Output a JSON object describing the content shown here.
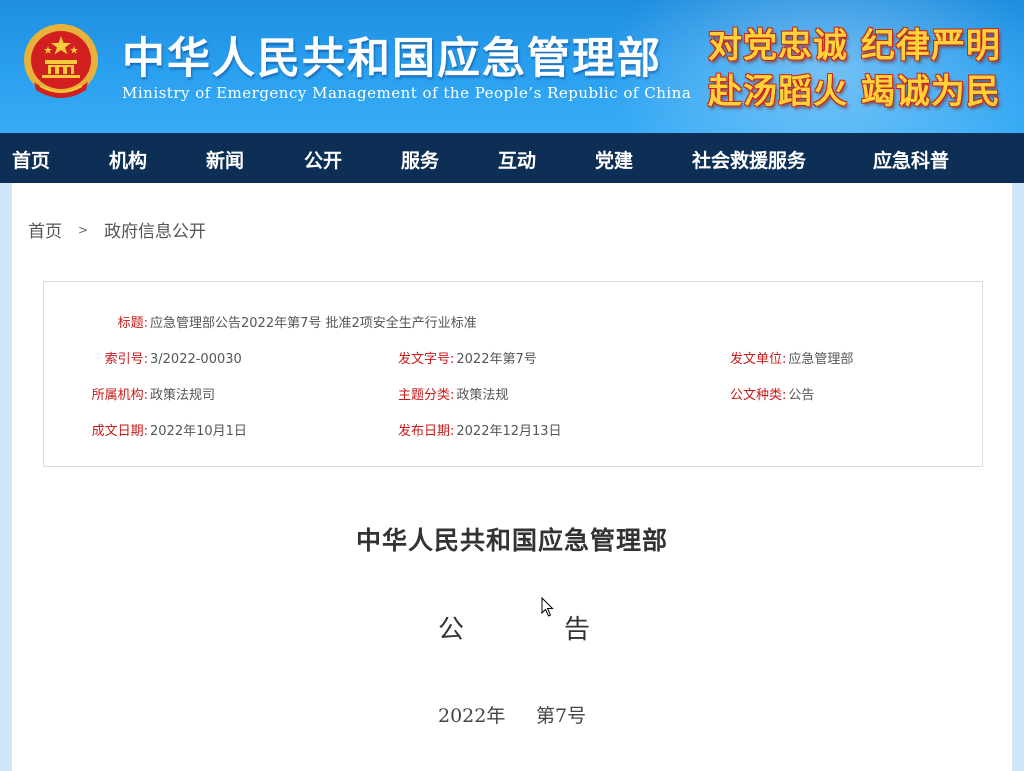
{
  "header": {
    "title": "中华人民共和国应急管理部",
    "subtitle": "Ministry of Emergency Management of the People’s Republic of China",
    "slogan_line1": "对党忠诚 纪律严明",
    "slogan_line2": "赴汤蹈火 竭诚为民",
    "emblem_icon": "national-emblem-icon"
  },
  "nav": {
    "items": [
      "首页",
      "机构",
      "新闻",
      "公开",
      "服务",
      "互动",
      "党建",
      "社会救援服务",
      "应急科普"
    ]
  },
  "breadcrumb": {
    "home": "首页",
    "separator": ">",
    "current": "政府信息公开"
  },
  "meta": {
    "title_label": "标题:",
    "title_value": "应急管理部公告2022年第7号 批准2项安全生产行业标准",
    "index_label": "索引号:",
    "index_value": "3/2022-00030",
    "doc_no_label": "发文字号:",
    "doc_no_value": "2022年第7号",
    "issuer_label": "发文单位:",
    "issuer_value": "应急管理部",
    "org_label": "所属机构:",
    "org_value": "政策法规司",
    "topic_label": "主题分类:",
    "topic_value": "政策法规",
    "doc_kind_label": "公文种类:",
    "doc_kind_value": "公告",
    "written_label": "成文日期:",
    "written_value": "2022年10月1日",
    "published_label": "发布日期:",
    "published_value": "2022年12月13日"
  },
  "document": {
    "org_name": "中华人民共和国应急管理部",
    "type_char1": "公",
    "type_char2": "告",
    "year": "2022年",
    "number": "第7号"
  },
  "colors": {
    "header_blue": "#2aa0f0",
    "nav_navy": "#0e2f55",
    "label_red": "#c81a1a",
    "slogan_yellow": "#ffd23a"
  }
}
